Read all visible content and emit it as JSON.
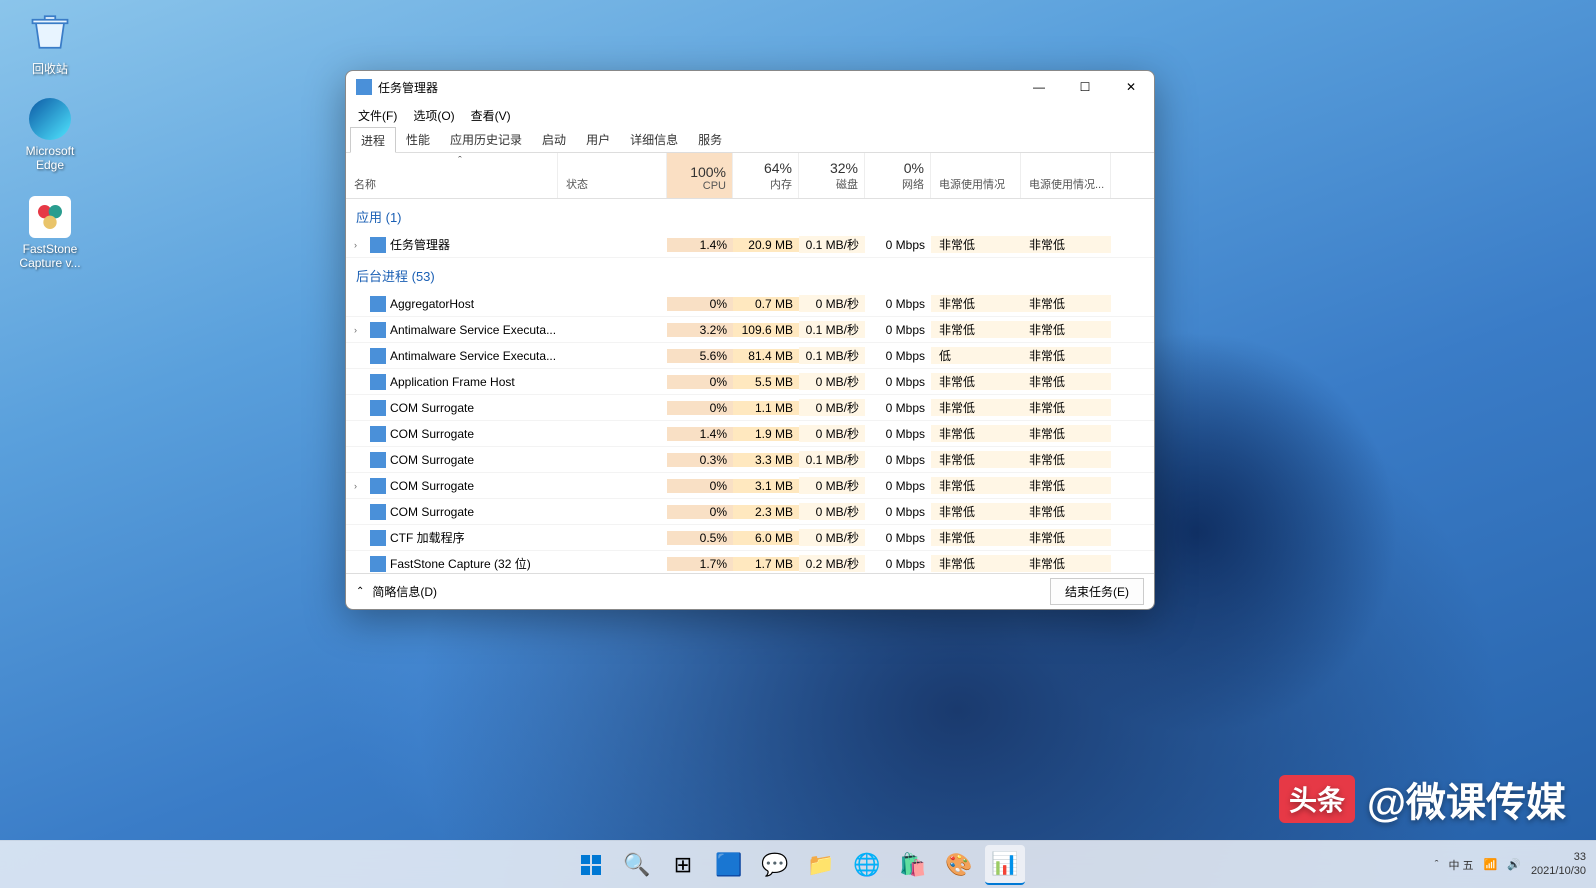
{
  "desktop": {
    "icons": [
      {
        "name": "回收站"
      },
      {
        "name": "Microsoft Edge"
      },
      {
        "name": "FastStone Capture v..."
      }
    ]
  },
  "window": {
    "title": "任务管理器",
    "menu": [
      "文件(F)",
      "选项(O)",
      "查看(V)"
    ],
    "tabs": [
      "进程",
      "性能",
      "应用历史记录",
      "启动",
      "用户",
      "详细信息",
      "服务"
    ],
    "columns": {
      "expand_marker": "ˆ",
      "name": "名称",
      "status": "状态",
      "cpu": {
        "pct": "100%",
        "label": "CPU"
      },
      "mem": {
        "pct": "64%",
        "label": "内存"
      },
      "disk": {
        "pct": "32%",
        "label": "磁盘"
      },
      "net": {
        "pct": "0%",
        "label": "网络"
      },
      "power": "电源使用情况",
      "power_trend": "电源使用情况..."
    },
    "groups": [
      {
        "title": "应用 (1)",
        "rows": [
          {
            "exp": "›",
            "name": "任务管理器",
            "cpu": "1.4%",
            "mem": "20.9 MB",
            "disk": "0.1 MB/秒",
            "net": "0 Mbps",
            "p1": "非常低",
            "p2": "非常低"
          }
        ]
      },
      {
        "title": "后台进程 (53)",
        "rows": [
          {
            "exp": "",
            "name": "AggregatorHost",
            "cpu": "0%",
            "mem": "0.7 MB",
            "disk": "0 MB/秒",
            "net": "0 Mbps",
            "p1": "非常低",
            "p2": "非常低"
          },
          {
            "exp": "›",
            "name": "Antimalware Service Executa...",
            "cpu": "3.2%",
            "mem": "109.6 MB",
            "disk": "0.1 MB/秒",
            "net": "0 Mbps",
            "p1": "非常低",
            "p2": "非常低"
          },
          {
            "exp": "",
            "name": "Antimalware Service Executa...",
            "cpu": "5.6%",
            "mem": "81.4 MB",
            "disk": "0.1 MB/秒",
            "net": "0 Mbps",
            "p1": "低",
            "p2": "非常低"
          },
          {
            "exp": "",
            "name": "Application Frame Host",
            "cpu": "0%",
            "mem": "5.5 MB",
            "disk": "0 MB/秒",
            "net": "0 Mbps",
            "p1": "非常低",
            "p2": "非常低"
          },
          {
            "exp": "",
            "name": "COM Surrogate",
            "cpu": "0%",
            "mem": "1.1 MB",
            "disk": "0 MB/秒",
            "net": "0 Mbps",
            "p1": "非常低",
            "p2": "非常低"
          },
          {
            "exp": "",
            "name": "COM Surrogate",
            "cpu": "1.4%",
            "mem": "1.9 MB",
            "disk": "0 MB/秒",
            "net": "0 Mbps",
            "p1": "非常低",
            "p2": "非常低"
          },
          {
            "exp": "",
            "name": "COM Surrogate",
            "cpu": "0.3%",
            "mem": "3.3 MB",
            "disk": "0.1 MB/秒",
            "net": "0 Mbps",
            "p1": "非常低",
            "p2": "非常低"
          },
          {
            "exp": "›",
            "name": "COM Surrogate",
            "cpu": "0%",
            "mem": "3.1 MB",
            "disk": "0 MB/秒",
            "net": "0 Mbps",
            "p1": "非常低",
            "p2": "非常低"
          },
          {
            "exp": "",
            "name": "COM Surrogate",
            "cpu": "0%",
            "mem": "2.3 MB",
            "disk": "0 MB/秒",
            "net": "0 Mbps",
            "p1": "非常低",
            "p2": "非常低"
          },
          {
            "exp": "",
            "name": "CTF 加载程序",
            "cpu": "0.5%",
            "mem": "6.0 MB",
            "disk": "0 MB/秒",
            "net": "0 Mbps",
            "p1": "非常低",
            "p2": "非常低"
          },
          {
            "exp": "",
            "name": "FastStone Capture (32 位)",
            "cpu": "1.7%",
            "mem": "1.7 MB",
            "disk": "0.2 MB/秒",
            "net": "0 Mbps",
            "p1": "非常低",
            "p2": "非常低"
          }
        ]
      }
    ],
    "footer": {
      "brief": "简略信息(D)",
      "end_task": "结束任务(E)"
    }
  },
  "taskbar": {
    "tray": {
      "ime": "中 五",
      "time": "33",
      "date": "2021/10/30"
    }
  },
  "watermark": {
    "logo": "头条",
    "text": "@微课传媒"
  }
}
